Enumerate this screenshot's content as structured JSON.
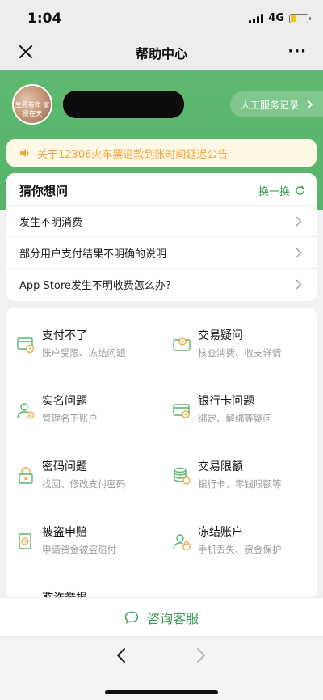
{
  "status_bar": {
    "time": "1:04",
    "network": "4G"
  },
  "nav": {
    "title": "帮助中心",
    "more": "···"
  },
  "profile": {
    "avatar_caption": "生死有命 富贵在天",
    "service_record": "人工服务记录"
  },
  "notice": {
    "text": "关于12306火车票退款到账时间延迟公告"
  },
  "guess": {
    "title": "猜你想问",
    "refresh": "换一换",
    "questions": [
      "发生不明消费",
      "部分用户支付结果不明确的说明",
      "App Store发生不明收费怎么办?"
    ]
  },
  "categories": [
    {
      "title": "支付不了",
      "sub": "账户受限、冻结问题",
      "icon": "card-warning-icon"
    },
    {
      "title": "交易疑问",
      "sub": "核查消费、收支详情",
      "icon": "transaction-query-icon"
    },
    {
      "title": "实名问题",
      "sub": "管理名下账户",
      "icon": "user-verify-icon"
    },
    {
      "title": "银行卡问题",
      "sub": "绑定、解绑等疑问",
      "icon": "bank-card-gear-icon"
    },
    {
      "title": "密码问题",
      "sub": "找回、修改支付密码",
      "icon": "password-lock-icon"
    },
    {
      "title": "交易限额",
      "sub": "银行卡、零钱限额等",
      "icon": "coins-stack-icon"
    },
    {
      "title": "被盗申赔",
      "sub": "申请资金被盗赔付",
      "icon": "claim-doc-icon"
    },
    {
      "title": "冻结账户",
      "sub": "手机丢失、资金保护",
      "icon": "user-lock-icon"
    },
    {
      "title": "欺诈举报",
      "sub": "",
      "icon": "report-icon"
    }
  ],
  "consult": {
    "label": "咨询客服"
  },
  "colors": {
    "primary_green": "#57b46a",
    "link_green": "#3b9a55",
    "notice_orange": "#f0a53c"
  }
}
